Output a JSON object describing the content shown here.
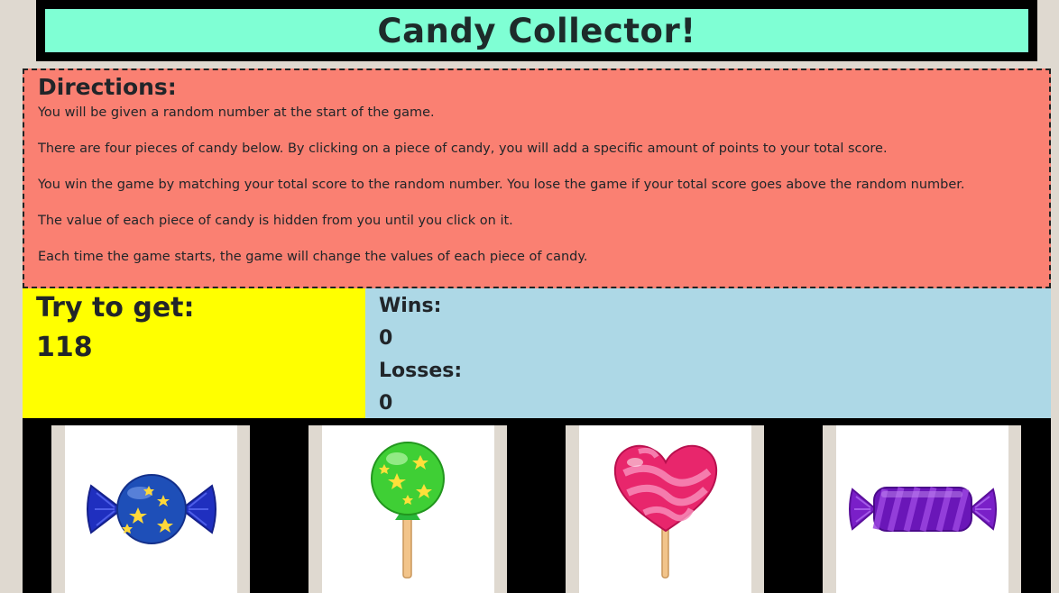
{
  "header": {
    "title": "Candy Collector!"
  },
  "directions": {
    "heading": "Directions:",
    "lines": [
      "You will be given a random number at the start of the game.",
      "There are four pieces of candy below. By clicking on a piece of candy, you will add a specific amount of points to your total score.",
      "You win the game by matching your total score to the random number. You lose the game if your total score goes above the random number.",
      "The value of each piece of candy is hidden from you until you click on it.",
      "Each time the game starts, the game will change the values of each piece of candy."
    ]
  },
  "target": {
    "label": "Try to get:",
    "value": "118"
  },
  "scores": {
    "wins_label": "Wins:",
    "wins": "0",
    "losses_label": "Losses:",
    "losses": "0"
  },
  "candies": [
    {
      "icon": "blue-star-wrapped-candy-icon"
    },
    {
      "icon": "green-star-lollipop-icon"
    },
    {
      "icon": "pink-heart-lollipop-icon"
    },
    {
      "icon": "purple-striped-wrapped-candy-icon"
    }
  ],
  "colors": {
    "title_bg": "#7fffd4",
    "directions_bg": "#fa8072",
    "target_bg": "#ffff00",
    "score_bg": "#add8e6",
    "page_bg": "#dfd9d0"
  }
}
